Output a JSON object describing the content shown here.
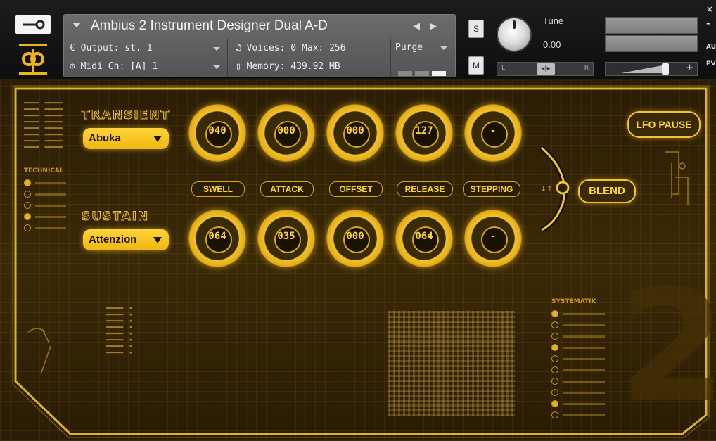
{
  "header": {
    "instrument_title": "Ambius 2 Instrument Designer Dual A-D",
    "output_label": "Output:",
    "output_value": "st. 1",
    "voices_label": "Voices:",
    "voices_value": "0",
    "max_label": "Max:",
    "max_value": "256",
    "purge_label": "Purge",
    "midi_label": "Midi Ch:",
    "midi_value": "[A] 1",
    "memory_label": "Memory:",
    "memory_value": "439.92 MB",
    "solo_label": "S",
    "mute_label": "M",
    "tune_label": "Tune",
    "tune_value": "0.00",
    "pan_left": "L",
    "pan_right": "R",
    "vol_minus": "-",
    "vol_plus": "+",
    "side_aux": "AUX",
    "side_pv": "PV",
    "nav_prev": "◀",
    "nav_next": "▶"
  },
  "transient": {
    "title": "TRANSIENT",
    "preset": "Abuka",
    "knobs": [
      {
        "name": "SWELL",
        "value": "040"
      },
      {
        "name": "ATTACK",
        "value": "000"
      },
      {
        "name": "OFFSET",
        "value": "000"
      },
      {
        "name": "RELEASE",
        "value": "127"
      },
      {
        "name": "STEPPING",
        "value": "-"
      }
    ]
  },
  "sustain": {
    "title": "SUSTAIN",
    "preset": "Attenzion",
    "knobs": [
      {
        "value": "064"
      },
      {
        "value": "035"
      },
      {
        "value": "000"
      },
      {
        "value": "064"
      },
      {
        "value": "-"
      }
    ]
  },
  "blend_label": "BLEND",
  "lfo_label": "LFO PAUSE",
  "big_number": "2",
  "technical_title": "TECHNICAL",
  "systematik_title": "SYSTEMATIK",
  "colors": {
    "accent": "#f1c232",
    "panel": "#2b1d06"
  }
}
